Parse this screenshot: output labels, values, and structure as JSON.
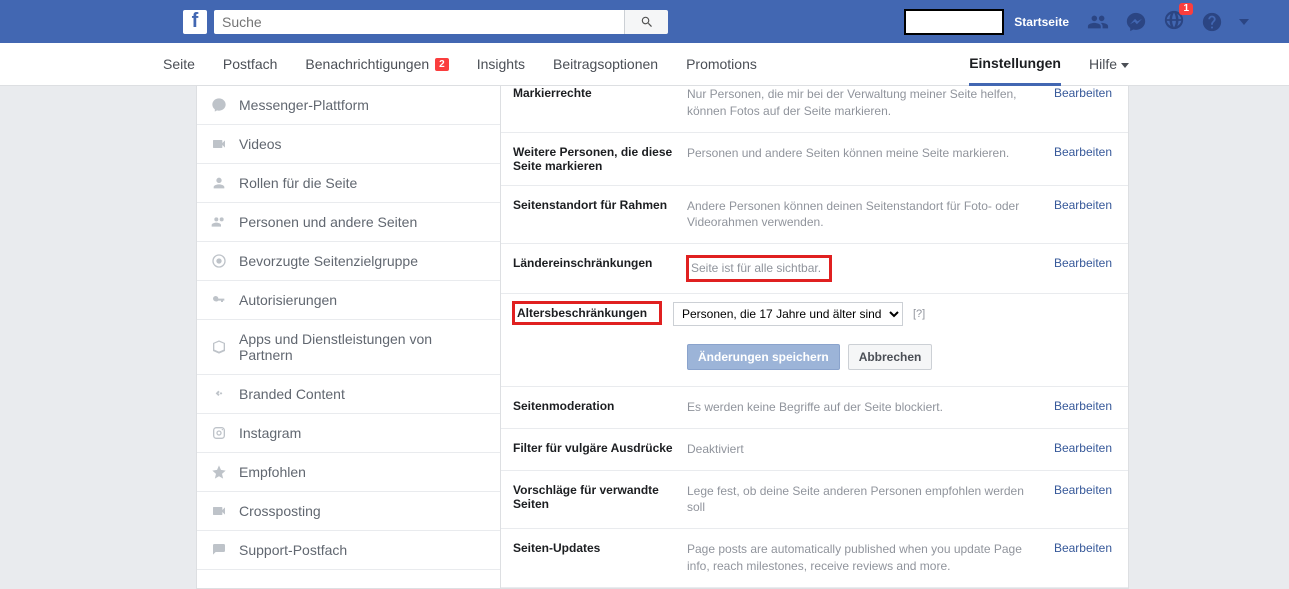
{
  "header": {
    "search_placeholder": "Suche",
    "home_label": "Startseite",
    "notif_count": "1"
  },
  "nav": {
    "items": [
      {
        "label": "Seite"
      },
      {
        "label": "Postfach"
      },
      {
        "label": "Benachrichtigungen",
        "badge": "2"
      },
      {
        "label": "Insights"
      },
      {
        "label": "Beitragsoptionen"
      },
      {
        "label": "Promotions"
      }
    ],
    "settings_label": "Einstellungen",
    "help_label": "Hilfe"
  },
  "sidebar": {
    "items": [
      {
        "label": "Messenger-Plattform"
      },
      {
        "label": "Videos"
      },
      {
        "label": "Rollen für die Seite"
      },
      {
        "label": "Personen und andere Seiten"
      },
      {
        "label": "Bevorzugte Seitenzielgruppe"
      },
      {
        "label": "Autorisierungen"
      },
      {
        "label": "Apps und Dienstleistungen von Partnern"
      },
      {
        "label": "Branded Content"
      },
      {
        "label": "Instagram"
      },
      {
        "label": "Empfohlen"
      },
      {
        "label": "Crossposting"
      },
      {
        "label": "Support-Postfach"
      }
    ]
  },
  "settings": {
    "edit_label": "Bearbeiten",
    "rows": {
      "tagrights": {
        "label": "Markierrechte",
        "desc": "Nur Personen, die mir bei der Verwaltung meiner Seite helfen, können Fotos auf der Seite markieren."
      },
      "others_tag": {
        "label": "Weitere Personen, die diese Seite markieren",
        "desc": "Personen und andere Seiten können meine Seite markieren."
      },
      "frame_loc": {
        "label": "Seitenstandort für Rahmen",
        "desc": "Andere Personen können deinen Seitenstandort für Foto- oder Videorahmen verwenden."
      },
      "country": {
        "label": "Ländereinschränkungen",
        "desc": "Seite ist für alle sichtbar."
      },
      "moderation": {
        "label": "Seitenmoderation",
        "desc": "Es werden keine Begriffe auf der Seite blockiert."
      },
      "profanity": {
        "label": "Filter für vulgäre Ausdrücke",
        "desc": "Deaktiviert"
      },
      "similar": {
        "label": "Vorschläge für verwandte Seiten",
        "desc": "Lege fest, ob deine Seite anderen Personen empfohlen werden soll"
      },
      "updates": {
        "label": "Seiten-Updates",
        "desc": "Page posts are automatically published when you update Page info, reach milestones, receive reviews and more."
      }
    },
    "age": {
      "label": "Altersbeschränkungen",
      "selected": "Personen, die 17 Jahre und älter sind",
      "help": "[?]",
      "save": "Änderungen speichern",
      "cancel": "Abbrechen"
    }
  }
}
